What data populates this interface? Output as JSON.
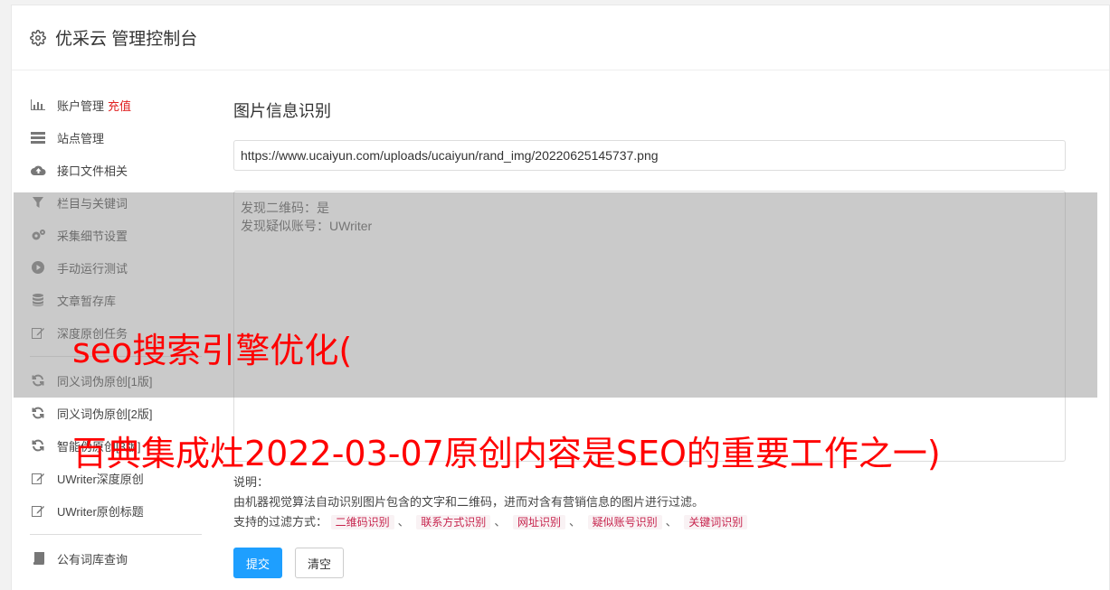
{
  "header": {
    "title": "优采云 管理控制台",
    "icon": "gear-icon"
  },
  "sidebar": {
    "items": [
      {
        "label": "账户管理",
        "badge": "充值",
        "icon": "bar-chart-icon"
      },
      {
        "label": "站点管理",
        "icon": "server-icon"
      },
      {
        "label": "接口文件相关",
        "icon": "cloud-upload-icon"
      },
      {
        "label": "栏目与关键词",
        "icon": "filter-icon"
      },
      {
        "label": "采集细节设置",
        "icon": "cogs-icon"
      },
      {
        "label": "手动运行测试",
        "icon": "play-circle-icon"
      },
      {
        "label": "文章暂存库",
        "icon": "database-icon"
      },
      {
        "label": "深度原创任务",
        "icon": "edit-icon"
      },
      {
        "label": "同义词伪原创[1版]",
        "icon": "refresh-icon"
      },
      {
        "label": "同义词伪原创[2版]",
        "icon": "refresh-icon"
      },
      {
        "label": "智能伪原创[3版]",
        "icon": "refresh-icon"
      },
      {
        "label": "UWriter深度原创",
        "icon": "edit-icon"
      },
      {
        "label": "UWriter原创标题",
        "icon": "edit-icon"
      },
      {
        "label": "公有词库查询",
        "icon": "book-icon"
      }
    ]
  },
  "main": {
    "title": "图片信息识别",
    "url_value": "https://www.ucaiyun.com/uploads/ucaiyun/rand_img/20220625145737.png",
    "result_lines": [
      "发现二维码：是",
      "发现疑似账号：UWriter"
    ],
    "notes": {
      "heading": "说明：",
      "description": "由机器视觉算法自动识别图片包含的文字和二维码，进而对含有营销信息的图片进行过滤。",
      "filter_label": "支持的过滤方式：",
      "filters": [
        "二维码识别",
        "联系方式识别",
        "网址识别",
        "疑似账号识别",
        "关键词识别"
      ],
      "separator": "、"
    },
    "buttons": {
      "submit": "提交",
      "clear": "清空"
    }
  },
  "overlay": {
    "line1": "seo搜索引擎优化(",
    "line2": "百典集成灶2022-03-07原创内容是SEO的重要工作之一)"
  },
  "colors": {
    "primary": "#1e9fff",
    "badge": "#e02020",
    "overlay_text": "#ff0000",
    "chip_text": "#c7254e"
  }
}
